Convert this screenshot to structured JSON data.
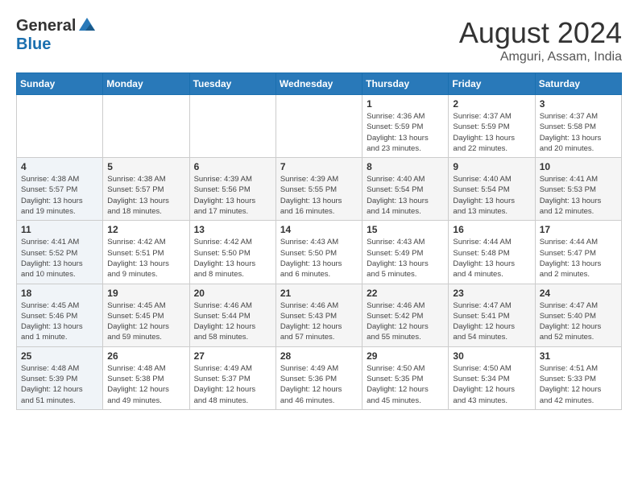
{
  "header": {
    "logo_general": "General",
    "logo_blue": "Blue",
    "month_title": "August 2024",
    "location": "Amguri, Assam, India"
  },
  "days_of_week": [
    "Sunday",
    "Monday",
    "Tuesday",
    "Wednesday",
    "Thursday",
    "Friday",
    "Saturday"
  ],
  "weeks": [
    [
      {
        "day": "",
        "info": ""
      },
      {
        "day": "",
        "info": ""
      },
      {
        "day": "",
        "info": ""
      },
      {
        "day": "",
        "info": ""
      },
      {
        "day": "1",
        "info": "Sunrise: 4:36 AM\nSunset: 5:59 PM\nDaylight: 13 hours\nand 23 minutes."
      },
      {
        "day": "2",
        "info": "Sunrise: 4:37 AM\nSunset: 5:59 PM\nDaylight: 13 hours\nand 22 minutes."
      },
      {
        "day": "3",
        "info": "Sunrise: 4:37 AM\nSunset: 5:58 PM\nDaylight: 13 hours\nand 20 minutes."
      }
    ],
    [
      {
        "day": "4",
        "info": "Sunrise: 4:38 AM\nSunset: 5:57 PM\nDaylight: 13 hours\nand 19 minutes."
      },
      {
        "day": "5",
        "info": "Sunrise: 4:38 AM\nSunset: 5:57 PM\nDaylight: 13 hours\nand 18 minutes."
      },
      {
        "day": "6",
        "info": "Sunrise: 4:39 AM\nSunset: 5:56 PM\nDaylight: 13 hours\nand 17 minutes."
      },
      {
        "day": "7",
        "info": "Sunrise: 4:39 AM\nSunset: 5:55 PM\nDaylight: 13 hours\nand 16 minutes."
      },
      {
        "day": "8",
        "info": "Sunrise: 4:40 AM\nSunset: 5:54 PM\nDaylight: 13 hours\nand 14 minutes."
      },
      {
        "day": "9",
        "info": "Sunrise: 4:40 AM\nSunset: 5:54 PM\nDaylight: 13 hours\nand 13 minutes."
      },
      {
        "day": "10",
        "info": "Sunrise: 4:41 AM\nSunset: 5:53 PM\nDaylight: 13 hours\nand 12 minutes."
      }
    ],
    [
      {
        "day": "11",
        "info": "Sunrise: 4:41 AM\nSunset: 5:52 PM\nDaylight: 13 hours\nand 10 minutes."
      },
      {
        "day": "12",
        "info": "Sunrise: 4:42 AM\nSunset: 5:51 PM\nDaylight: 13 hours\nand 9 minutes."
      },
      {
        "day": "13",
        "info": "Sunrise: 4:42 AM\nSunset: 5:50 PM\nDaylight: 13 hours\nand 8 minutes."
      },
      {
        "day": "14",
        "info": "Sunrise: 4:43 AM\nSunset: 5:50 PM\nDaylight: 13 hours\nand 6 minutes."
      },
      {
        "day": "15",
        "info": "Sunrise: 4:43 AM\nSunset: 5:49 PM\nDaylight: 13 hours\nand 5 minutes."
      },
      {
        "day": "16",
        "info": "Sunrise: 4:44 AM\nSunset: 5:48 PM\nDaylight: 13 hours\nand 4 minutes."
      },
      {
        "day": "17",
        "info": "Sunrise: 4:44 AM\nSunset: 5:47 PM\nDaylight: 13 hours\nand 2 minutes."
      }
    ],
    [
      {
        "day": "18",
        "info": "Sunrise: 4:45 AM\nSunset: 5:46 PM\nDaylight: 13 hours\nand 1 minute."
      },
      {
        "day": "19",
        "info": "Sunrise: 4:45 AM\nSunset: 5:45 PM\nDaylight: 12 hours\nand 59 minutes."
      },
      {
        "day": "20",
        "info": "Sunrise: 4:46 AM\nSunset: 5:44 PM\nDaylight: 12 hours\nand 58 minutes."
      },
      {
        "day": "21",
        "info": "Sunrise: 4:46 AM\nSunset: 5:43 PM\nDaylight: 12 hours\nand 57 minutes."
      },
      {
        "day": "22",
        "info": "Sunrise: 4:46 AM\nSunset: 5:42 PM\nDaylight: 12 hours\nand 55 minutes."
      },
      {
        "day": "23",
        "info": "Sunrise: 4:47 AM\nSunset: 5:41 PM\nDaylight: 12 hours\nand 54 minutes."
      },
      {
        "day": "24",
        "info": "Sunrise: 4:47 AM\nSunset: 5:40 PM\nDaylight: 12 hours\nand 52 minutes."
      }
    ],
    [
      {
        "day": "25",
        "info": "Sunrise: 4:48 AM\nSunset: 5:39 PM\nDaylight: 12 hours\nand 51 minutes."
      },
      {
        "day": "26",
        "info": "Sunrise: 4:48 AM\nSunset: 5:38 PM\nDaylight: 12 hours\nand 49 minutes."
      },
      {
        "day": "27",
        "info": "Sunrise: 4:49 AM\nSunset: 5:37 PM\nDaylight: 12 hours\nand 48 minutes."
      },
      {
        "day": "28",
        "info": "Sunrise: 4:49 AM\nSunset: 5:36 PM\nDaylight: 12 hours\nand 46 minutes."
      },
      {
        "day": "29",
        "info": "Sunrise: 4:50 AM\nSunset: 5:35 PM\nDaylight: 12 hours\nand 45 minutes."
      },
      {
        "day": "30",
        "info": "Sunrise: 4:50 AM\nSunset: 5:34 PM\nDaylight: 12 hours\nand 43 minutes."
      },
      {
        "day": "31",
        "info": "Sunrise: 4:51 AM\nSunset: 5:33 PM\nDaylight: 12 hours\nand 42 minutes."
      }
    ]
  ]
}
